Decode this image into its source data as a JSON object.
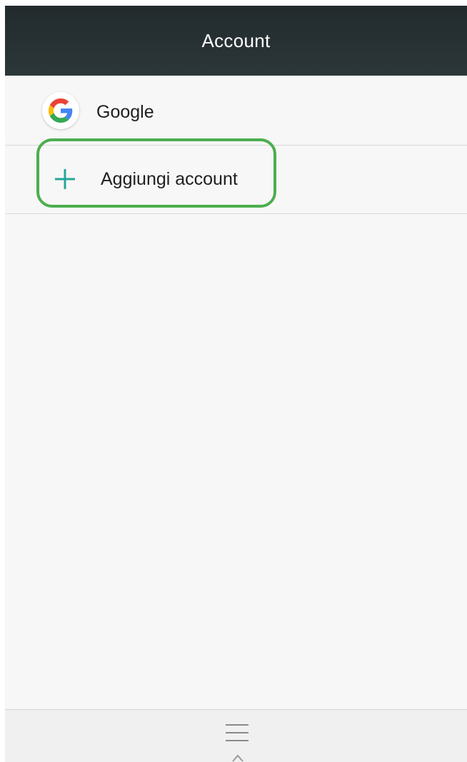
{
  "header": {
    "title": "Account"
  },
  "accounts": [
    {
      "label": "Google",
      "icon": "google-logo-icon"
    }
  ],
  "add_account": {
    "label": "Aggiungi account",
    "icon": "plus-icon"
  },
  "bottom_bar": {
    "icon": "menu-icon"
  },
  "colors": {
    "header_bg": "#263238",
    "accent": "#26a69a",
    "highlight": "#4cae4f",
    "background": "#f7f7f7"
  }
}
